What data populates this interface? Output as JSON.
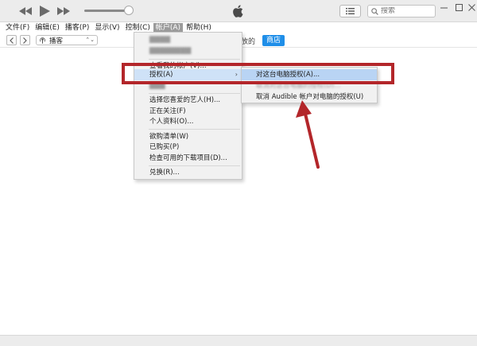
{
  "menubar": {
    "items": [
      {
        "label": "文件(F)"
      },
      {
        "label": "编辑(E)"
      },
      {
        "label": "播客(P)"
      },
      {
        "label": "显示(V)"
      },
      {
        "label": "控制(C)"
      },
      {
        "label": "帐户(A)"
      },
      {
        "label": "帮助(H)"
      }
    ],
    "active_index": 5
  },
  "toolbar": {
    "search_placeholder": "搜索",
    "volume": 0.9,
    "icons": [
      "rewind-icon",
      "play-icon",
      "fast-forward-icon",
      "apple-icon",
      "list-icon",
      "search-icon"
    ]
  },
  "navbar": {
    "source_select": "播客",
    "partial_label": "放的",
    "store_tab": "商店"
  },
  "account_menu": {
    "items": [
      {
        "label": "查看我的帐户(V)..."
      },
      {
        "label": "授权(A)"
      },
      {
        "label": "选择您喜爱的艺人(H)..."
      },
      {
        "label": "正在关注(F)"
      },
      {
        "label": "个人资料(O)..."
      },
      {
        "label": "欲购清单(W)"
      },
      {
        "label": "已购买(P)"
      },
      {
        "label": "检查可用的下载项目(D)..."
      },
      {
        "label": "兑换(R)..."
      }
    ],
    "submenu": [
      {
        "label": "对这台电脑授权(A)..."
      },
      {
        "label": "取消对这台电脑的授权(D)..."
      },
      {
        "label": "取消 Audible 帐户对电脑的授权(U)"
      }
    ]
  },
  "colors": {
    "annotation": "#b3262a",
    "highlight": "#b9d4f4",
    "store_tab": "#1f8ee8",
    "menu_active": "#9b9b9b"
  }
}
